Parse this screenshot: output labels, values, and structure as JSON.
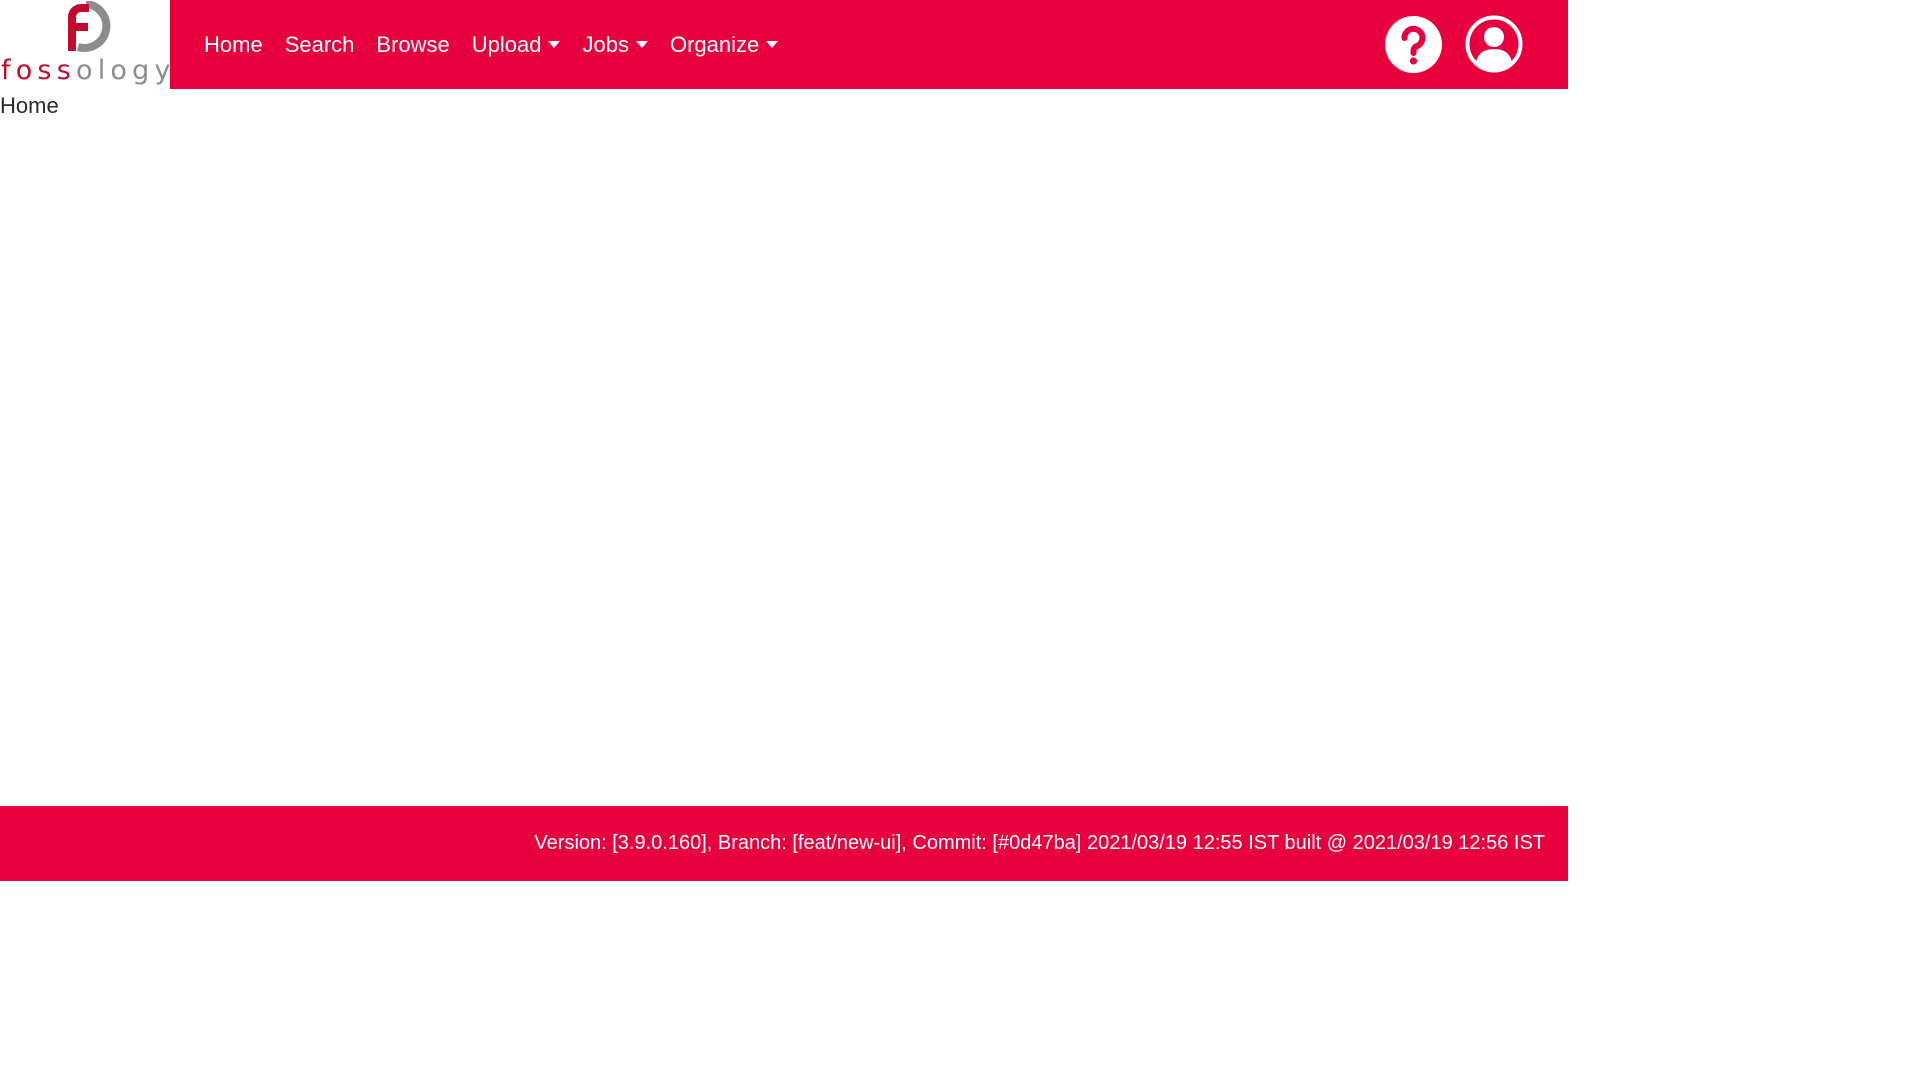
{
  "brand": {
    "logo_text_part1": "foss",
    "logo_text_part2": "ology",
    "primary_color": "#e8003e",
    "logo_red": "#c40a2c",
    "logo_gray": "#8c8c8c"
  },
  "nav": {
    "items": [
      {
        "label": "Home",
        "dropdown": false
      },
      {
        "label": "Search",
        "dropdown": false
      },
      {
        "label": "Browse",
        "dropdown": false
      },
      {
        "label": "Upload",
        "dropdown": true
      },
      {
        "label": "Jobs",
        "dropdown": true
      },
      {
        "label": "Organize",
        "dropdown": true
      }
    ],
    "right_icons": [
      "help-icon",
      "user-icon"
    ]
  },
  "breadcrumb": {
    "current": "Home"
  },
  "footer": {
    "version_text": "Version: [3.9.0.160], Branch: [feat/new-ui], Commit: [#0d47ba] 2021/03/19 12:55 IST built @ 2021/03/19 12:56 IST"
  }
}
